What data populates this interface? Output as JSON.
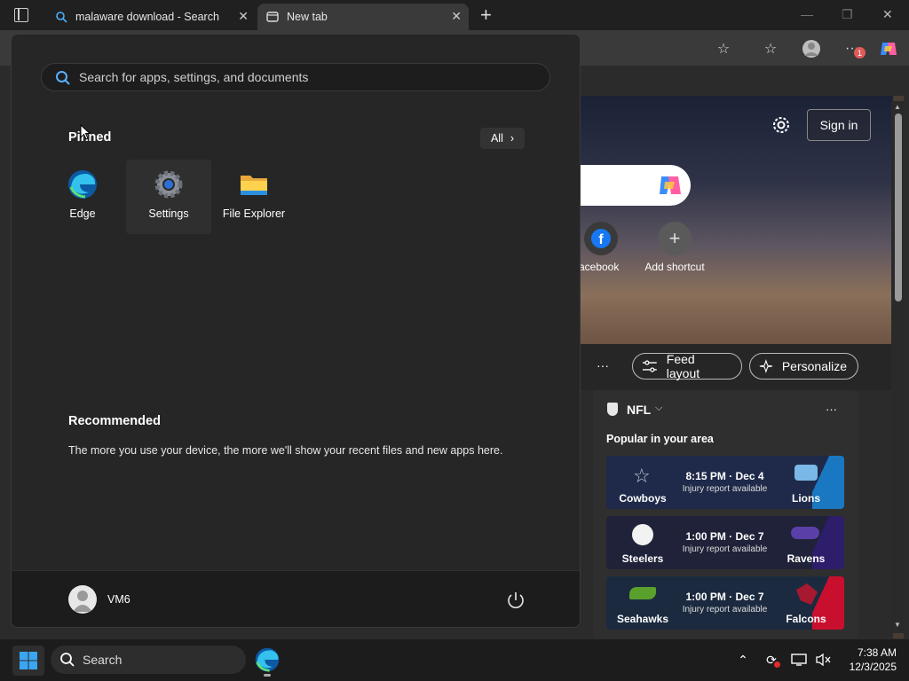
{
  "browser": {
    "tabs": [
      {
        "title": "malaware download - Search",
        "icon": "search-icon"
      },
      {
        "title": "New tab",
        "icon": "newtab-icon"
      }
    ],
    "new_tab_glyph": "+",
    "window_controls": {
      "minimize": "—",
      "restore": "❐",
      "close": "✕"
    },
    "profile_badge": "1"
  },
  "newtab_page": {
    "sign_in_label": "Sign in",
    "shortcuts": [
      {
        "label": "Facebook",
        "icon": "facebook-icon"
      },
      {
        "label": "Add shortcut",
        "icon": "plus-icon"
      }
    ],
    "feed_more": "···",
    "feed_layout_label": "Feed layout",
    "personalize_label": "Personalize",
    "nfl_card": {
      "title": "NFL",
      "subtitle": "Popular in your area",
      "more": "···",
      "games": [
        {
          "home": "Cowboys",
          "away": "Lions",
          "time": "8:15 PM · Dec 4",
          "note": "Injury report available",
          "bg": "#1f2a4a",
          "stripe": "#1a78c2"
        },
        {
          "home": "Steelers",
          "away": "Ravens",
          "time": "1:00 PM · Dec 7",
          "note": "Injury report available",
          "bg": "#1f2238",
          "stripe": "#2e1d6b"
        },
        {
          "home": "Seahawks",
          "away": "Falcons",
          "time": "1:00 PM · Dec 7",
          "note": "Injury report available",
          "bg": "#1c2a40",
          "stripe": "#c8102e"
        }
      ]
    }
  },
  "start_menu": {
    "search_placeholder": "Search for apps, settings, and documents",
    "pinned_label": "Pinned",
    "all_label": "All",
    "pinned_apps": [
      {
        "label": "Edge",
        "icon": "edge-icon"
      },
      {
        "label": "Settings",
        "icon": "settings-gear-icon"
      },
      {
        "label": "File Explorer",
        "icon": "folder-icon"
      }
    ],
    "recommended_label": "Recommended",
    "recommended_text": "The more you use your device, the more we'll show your recent files and new apps here.",
    "user_name": "VM6"
  },
  "taskbar": {
    "search_label": "Search",
    "time": "7:38 AM",
    "date": "12/3/2025"
  },
  "colors": {
    "accent": "#0a84ff",
    "start_bg": "#262626",
    "taskbar_bg": "#1c1c1c"
  }
}
